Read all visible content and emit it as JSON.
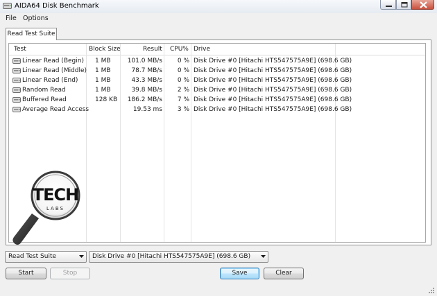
{
  "window": {
    "title": "AIDA64 Disk Benchmark"
  },
  "menu": {
    "items": [
      "File",
      "Options"
    ]
  },
  "tabs": [
    {
      "label": "Read Test Suite",
      "active": true
    }
  ],
  "table": {
    "columns": [
      "Test",
      "Block Size",
      "Result",
      "CPU%",
      "Drive"
    ],
    "rows": [
      {
        "test": "Linear Read (Begin)",
        "block": "1 MB",
        "result": "101.0 MB/s",
        "cpu": "0 %",
        "drive": "Disk Drive #0  [Hitachi HTS547575A9E]  (698.6 GB)"
      },
      {
        "test": "Linear Read (Middle)",
        "block": "1 MB",
        "result": "78.7 MB/s",
        "cpu": "0 %",
        "drive": "Disk Drive #0  [Hitachi HTS547575A9E]  (698.6 GB)"
      },
      {
        "test": "Linear Read (End)",
        "block": "1 MB",
        "result": "43.3 MB/s",
        "cpu": "0 %",
        "drive": "Disk Drive #0  [Hitachi HTS547575A9E]  (698.6 GB)"
      },
      {
        "test": "Random Read",
        "block": "1 MB",
        "result": "39.8 MB/s",
        "cpu": "2 %",
        "drive": "Disk Drive #0  [Hitachi HTS547575A9E]  (698.6 GB)"
      },
      {
        "test": "Buffered Read",
        "block": "128 KB",
        "result": "186.2 MB/s",
        "cpu": "7 %",
        "drive": "Disk Drive #0  [Hitachi HTS547575A9E]  (698.6 GB)"
      },
      {
        "test": "Average Read Access",
        "block": "",
        "result": "19.53 ms",
        "cpu": "3 %",
        "drive": "Disk Drive #0  [Hitachi HTS547575A9E]  (698.6 GB)"
      }
    ]
  },
  "logo": {
    "text_top": "TECH",
    "text_bottom": "LABS"
  },
  "controls": {
    "suite_select": "Read Test Suite",
    "drive_select": "Disk Drive #0  [Hitachi HTS547575A9E]  (698.6 GB)",
    "start_label": "Start",
    "stop_label": "Stop",
    "save_label": "Save",
    "clear_label": "Clear"
  },
  "colors": {
    "accent_button": "#bee6fd",
    "close_button": "#c9503c",
    "disabled_text": "#a0a0a0"
  }
}
